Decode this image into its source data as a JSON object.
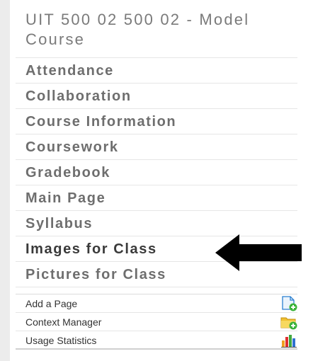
{
  "course": {
    "title": "UIT 500 02 500 02 - Model Course"
  },
  "menu": {
    "items": [
      {
        "label": "Attendance"
      },
      {
        "label": "Collaboration"
      },
      {
        "label": "Course Information"
      },
      {
        "label": "Coursework"
      },
      {
        "label": "Gradebook"
      },
      {
        "label": "Main Page"
      },
      {
        "label": "Syllabus"
      },
      {
        "label": "Images for Class"
      },
      {
        "label": "Pictures for Class"
      }
    ]
  },
  "tools": {
    "items": [
      {
        "label": "Add a Page",
        "icon": "add-page-icon"
      },
      {
        "label": "Context Manager",
        "icon": "folder-add-icon"
      },
      {
        "label": "Usage Statistics",
        "icon": "bar-chart-icon"
      }
    ]
  },
  "colors": {
    "title": "#7a7a7a",
    "menu_text": "#6e6e6e",
    "menu_text_dark": "#3a3a3a",
    "divider": "#e6e6e6",
    "arrow": "#000000",
    "icon_blue": "#2a7fd0",
    "icon_green": "#3cb43c",
    "icon_yellow": "#f0c030",
    "bar_red": "#e03030",
    "bar_orange": "#f0a020",
    "bar_green": "#40a840",
    "bar_blue": "#3070d0"
  }
}
